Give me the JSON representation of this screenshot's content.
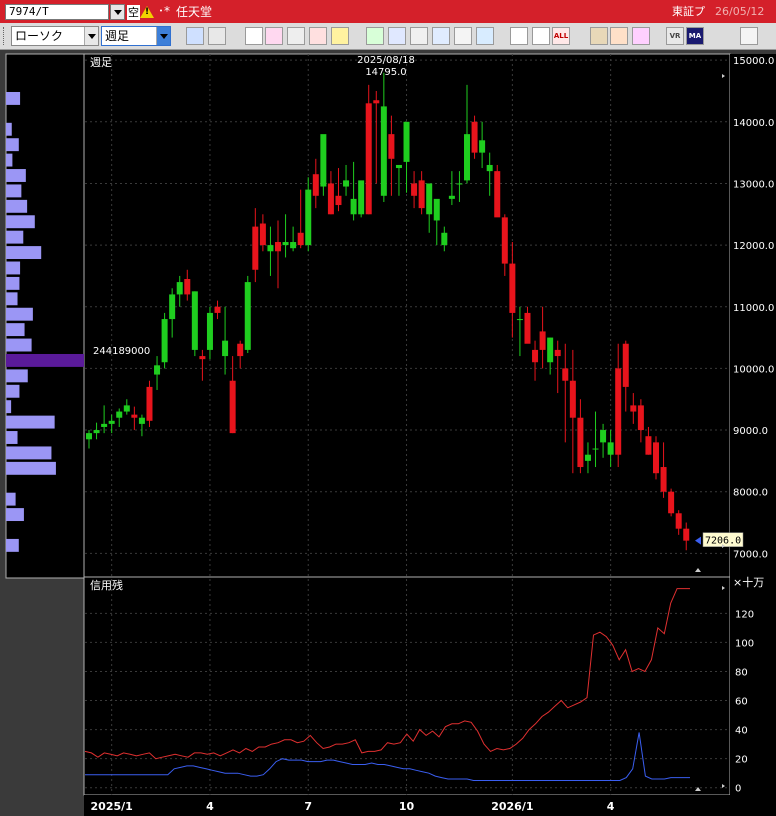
{
  "titlebar": {
    "symbol": "7974/T",
    "kara_badge": "空",
    "warn_icon": "warning-triangle-icon",
    "dot_mark": "･*",
    "company": "任天堂",
    "market": "東証プ",
    "date": "26/05/12"
  },
  "toolbar": {
    "chart_type": "ローソク",
    "period": "週足",
    "buttons": [
      "magnifier-icon",
      "grid-icon",
      "download-icon",
      "zoom-icon",
      "table-icon",
      "alert-icon",
      "warning-icon",
      "pen-icon",
      "line-tool-icon",
      "cursor-icon",
      "arrow-icon",
      "document-icon",
      "trash-icon",
      "candle-icon",
      "bar-icon",
      "ALL",
      "settings-icon",
      "wrench-icon",
      "color-icon",
      "VR",
      "MA",
      "list-icon"
    ]
  },
  "colors": {
    "background": "#000000",
    "up_candle": "#1fce1f",
    "down_candle": "#e8141c",
    "credit_buy": "#e03030",
    "credit_sell": "#3a5ef0",
    "volume_bar": "#9b96f5",
    "volume_max": "#5a1a9a"
  },
  "chart_data": {
    "type": "candlestick",
    "period_label": "週足",
    "high_annotation": {
      "date": "2025/08/18",
      "value": "14795.0"
    },
    "last_price_label": "7206.0",
    "ylim": [
      6600,
      15100
    ],
    "yticks": [
      "15000.0",
      "14000.0",
      "13000.0",
      "12000.0",
      "11000.0",
      "10000.0",
      "9000.0",
      "8000.0",
      "7000.0"
    ],
    "ytick_values": [
      15000,
      14000,
      13000,
      12000,
      11000,
      10000,
      9000,
      8000,
      7000
    ],
    "xticks": [
      "2025/1",
      "4",
      "7",
      "10",
      "2026/1",
      "4"
    ],
    "xtick_weeks": [
      3,
      16,
      29,
      42,
      56,
      69
    ],
    "candles": [
      [
        8850,
        9000,
        8700,
        8950
      ],
      [
        8950,
        9120,
        8850,
        9000
      ],
      [
        9050,
        9400,
        8950,
        9100
      ],
      [
        9100,
        9250,
        8950,
        9150
      ],
      [
        9200,
        9350,
        9050,
        9300
      ],
      [
        9300,
        9500,
        9250,
        9400
      ],
      [
        9250,
        9380,
        9000,
        9200
      ],
      [
        9100,
        9250,
        8900,
        9200
      ],
      [
        9700,
        9800,
        9050,
        9150
      ],
      [
        9900,
        10200,
        9650,
        10050
      ],
      [
        10100,
        10900,
        10000,
        10800
      ],
      [
        10800,
        11300,
        10500,
        11200
      ],
      [
        11200,
        11500,
        11000,
        11400
      ],
      [
        11450,
        11600,
        11100,
        11200
      ],
      [
        10300,
        11250,
        10200,
        11250
      ],
      [
        10200,
        10300,
        9800,
        10150
      ],
      [
        10300,
        11000,
        10150,
        10900
      ],
      [
        11000,
        11100,
        10800,
        10900
      ],
      [
        10200,
        11000,
        9900,
        10450
      ],
      [
        9800,
        10200,
        8950,
        8950
      ],
      [
        10400,
        10450,
        10000,
        10200
      ],
      [
        10300,
        11500,
        10250,
        11400
      ],
      [
        12300,
        12600,
        11400,
        11600
      ],
      [
        12350,
        12500,
        11900,
        12000
      ],
      [
        11900,
        12300,
        11500,
        12000
      ],
      [
        12050,
        12400,
        11300,
        11900
      ],
      [
        12000,
        12500,
        11800,
        12050
      ],
      [
        11950,
        12300,
        11900,
        12050
      ],
      [
        12200,
        12900,
        11950,
        12000
      ],
      [
        12000,
        13100,
        11900,
        12900
      ],
      [
        13150,
        13400,
        12600,
        12800
      ],
      [
        12950,
        13600,
        12800,
        13800
      ],
      [
        13000,
        13200,
        12500,
        12500
      ],
      [
        12800,
        13250,
        12550,
        12650
      ],
      [
        12950,
        13300,
        12800,
        13050
      ],
      [
        12500,
        13350,
        12400,
        12750
      ],
      [
        12500,
        12800,
        12450,
        13050
      ],
      [
        14300,
        14600,
        12500,
        12500
      ],
      [
        14350,
        14500,
        13000,
        14300
      ],
      [
        12800,
        14795,
        12700,
        14250
      ],
      [
        13800,
        14100,
        12800,
        13400
      ],
      [
        13250,
        13300,
        12800,
        13300
      ],
      [
        13350,
        13900,
        12850,
        14000
      ],
      [
        13000,
        13200,
        12600,
        12800
      ],
      [
        13050,
        13200,
        12500,
        12600
      ],
      [
        12500,
        12700,
        12200,
        13000
      ],
      [
        12400,
        12500,
        12000,
        12750
      ],
      [
        12000,
        12300,
        11900,
        12200
      ],
      [
        12750,
        13200,
        12650,
        12800
      ],
      [
        13000,
        13200,
        12700,
        13000
      ],
      [
        13050,
        14600,
        13000,
        13800
      ],
      [
        14000,
        14100,
        13400,
        13500
      ],
      [
        13500,
        14000,
        13250,
        13700
      ],
      [
        13200,
        13500,
        12800,
        13300
      ],
      [
        13200,
        13300,
        12700,
        12450
      ],
      [
        12450,
        12500,
        11500,
        11700
      ],
      [
        11700,
        12050,
        10500,
        10900
      ],
      [
        10800,
        11000,
        10200,
        10800
      ],
      [
        10900,
        11000,
        10500,
        10400
      ],
      [
        10300,
        10450,
        9800,
        10100
      ],
      [
        10600,
        11000,
        10000,
        10300
      ],
      [
        10100,
        10500,
        9900,
        10500
      ],
      [
        10300,
        10450,
        9600,
        10200
      ],
      [
        10000,
        10400,
        8800,
        9800
      ],
      [
        9800,
        10300,
        8300,
        9200
      ],
      [
        9200,
        9500,
        8300,
        8400
      ],
      [
        8500,
        8800,
        8300,
        8600
      ],
      [
        8700,
        9300,
        8400,
        8700
      ],
      [
        8800,
        9100,
        8550,
        9000
      ],
      [
        8600,
        9000,
        8400,
        8800
      ],
      [
        10000,
        10400,
        8400,
        8600
      ],
      [
        10400,
        10450,
        9300,
        9700
      ],
      [
        9400,
        9600,
        9100,
        9300
      ],
      [
        9400,
        9500,
        8800,
        9000
      ],
      [
        8900,
        9050,
        8600,
        8600
      ],
      [
        8800,
        8900,
        8200,
        8300
      ],
      [
        8400,
        8800,
        7900,
        8000
      ],
      [
        8000,
        8050,
        7600,
        7650
      ],
      [
        7650,
        7700,
        7300,
        7400
      ],
      [
        7400,
        7500,
        7050,
        7206
      ]
    ],
    "volume_profile": {
      "max_value_label": "244189000",
      "price_bins_top": [
        14500,
        14000,
        13750,
        13500,
        13250,
        13000,
        12750,
        12500,
        12250,
        12000,
        11750,
        11500,
        11250,
        11000,
        10750,
        10500,
        10250,
        10000,
        9750,
        9500,
        9250,
        9000,
        8750,
        8500,
        8250,
        8000,
        7750,
        7500,
        7250,
        7000
      ],
      "volumes": [
        0.22,
        0.09,
        0.2,
        0.1,
        0.31,
        0.24,
        0.33,
        0.45,
        0.27,
        0.55,
        0.22,
        0.21,
        0.18,
        0.42,
        0.29,
        0.4,
        1.0,
        0.34,
        0.21,
        0.08,
        0.76,
        0.18,
        0.71,
        0.78,
        0.0,
        0.15,
        0.28,
        0.0,
        0.2,
        0.0
      ]
    },
    "sub_chart": {
      "title": "信用残",
      "unit": "×十万",
      "ylim": [
        -5,
        145
      ],
      "yticks": [
        "120",
        "100",
        "80",
        "60",
        "40",
        "20",
        "0"
      ],
      "ytick_values": [
        120,
        100,
        80,
        60,
        40,
        20,
        0
      ],
      "series": [
        {
          "values": [
            25,
            24,
            21,
            24,
            23,
            22,
            24,
            23,
            22,
            23,
            24,
            20,
            21,
            22,
            23,
            22,
            21,
            24,
            24,
            23,
            24,
            22,
            24,
            26,
            24,
            27,
            25,
            28,
            28,
            30,
            31,
            33,
            33,
            31,
            32,
            36,
            31,
            27,
            28,
            30,
            30,
            31,
            33,
            24,
            25,
            25,
            26,
            31,
            30,
            31,
            37,
            32,
            40,
            36,
            39,
            35,
            42,
            44,
            44,
            46,
            45,
            39,
            30,
            25,
            27,
            26,
            27,
            30,
            34,
            40,
            44,
            49,
            52,
            56,
            60,
            55,
            57,
            59,
            62,
            105,
            107,
            104,
            98,
            88,
            95,
            80,
            82,
            80,
            88,
            110,
            106,
            127,
            137,
            137,
            137
          ]
        },
        {
          "values": [
            9,
            9,
            9,
            9,
            9,
            9,
            9,
            9,
            9,
            9,
            9,
            9,
            9,
            9,
            13,
            14,
            15,
            15,
            14,
            13,
            12,
            11,
            10,
            10,
            10,
            9,
            8,
            8,
            9,
            13,
            18,
            20,
            19,
            19,
            19,
            18,
            18,
            18,
            19,
            19,
            18,
            17,
            16,
            16,
            16,
            17,
            16,
            16,
            15,
            14,
            13,
            13,
            12,
            11,
            10,
            8,
            7,
            6,
            6,
            6,
            6,
            5,
            5,
            5,
            5,
            5,
            5,
            5,
            5,
            5,
            5,
            5,
            5,
            5,
            5,
            5,
            5,
            5,
            5,
            5,
            5,
            5,
            5,
            5,
            5,
            7,
            13,
            38,
            8,
            6,
            6,
            6,
            7,
            7,
            7,
            7
          ]
        }
      ]
    }
  }
}
